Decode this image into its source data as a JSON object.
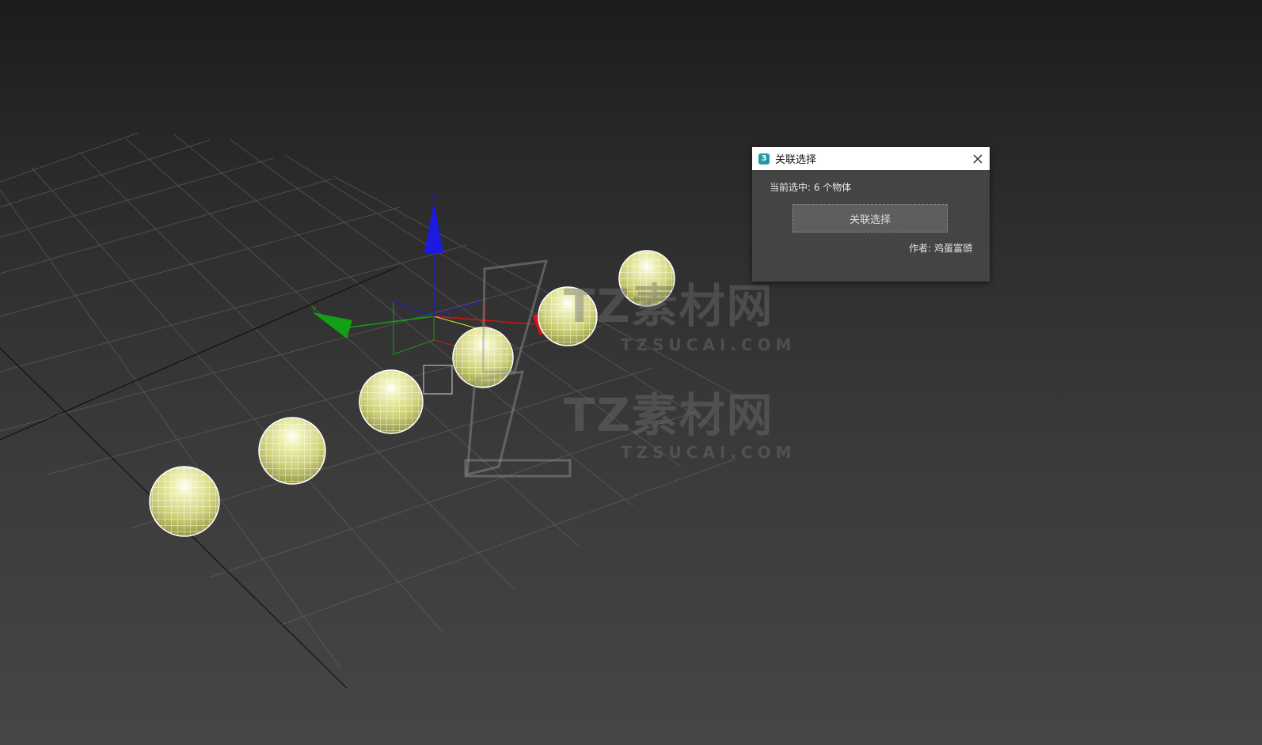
{
  "dialog": {
    "app_icon_glyph": "3",
    "title": "关联选择",
    "selection_status": "当前选中: 6 个物体",
    "button_label": "关联选择",
    "author": "作者: 鸡蛋富頭",
    "close_icon": "close-icon"
  },
  "viewport": {
    "gizmo_axis_z": "Z",
    "gizmo_axis_y": "Y",
    "object_count": 6,
    "colors": {
      "sphere_fill": "#d6d88a",
      "sphere_wire": "#ffffff",
      "axis_x": "#d41414",
      "axis_y": "#14a014",
      "axis_z": "#1a1ae0",
      "grid_line": "#6a6a6a",
      "grid_main_line": "#111111"
    }
  },
  "watermark": {
    "brand_big": "TZ素材网",
    "brand_small": "TZSUCAI.COM"
  }
}
